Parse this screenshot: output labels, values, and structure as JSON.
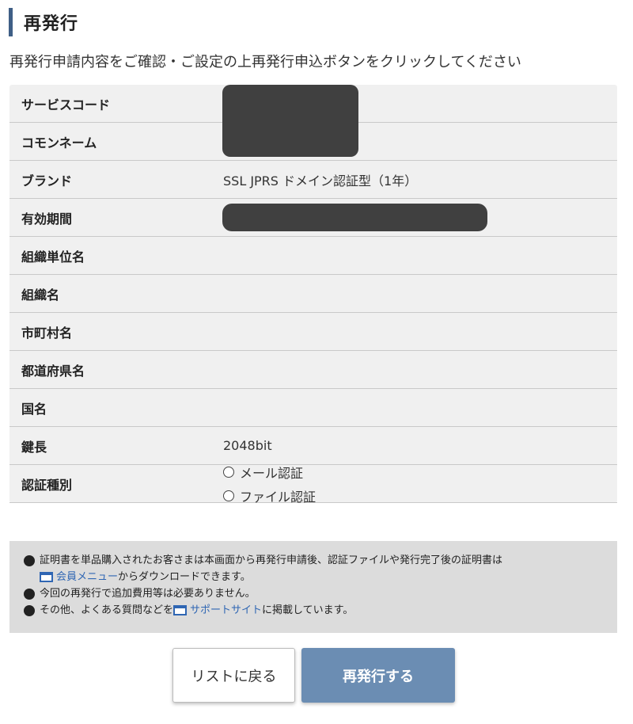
{
  "header": {
    "title": "再発行"
  },
  "instruction": "再発行申請内容をご確認・ご設定の上再発行申込ボタンをクリックしてください",
  "details": {
    "rows": [
      {
        "label": "サービスコード",
        "value": ""
      },
      {
        "label": "コモンネーム",
        "value": ""
      },
      {
        "label": "ブランド",
        "value": "SSL JPRS ドメイン認証型（1年）"
      },
      {
        "label": "有効期間",
        "value": ""
      },
      {
        "label": "組織単位名",
        "value": ""
      },
      {
        "label": "組織名",
        "value": ""
      },
      {
        "label": "市町村名",
        "value": ""
      },
      {
        "label": "都道府県名",
        "value": ""
      },
      {
        "label": "国名",
        "value": ""
      },
      {
        "label": "鍵長",
        "value": "2048bit"
      }
    ],
    "auth": {
      "label": "認証種別",
      "options": [
        "メール認証",
        "ファイル認証"
      ]
    }
  },
  "notes": {
    "line1_text": "証明書を単品購入されたお客さまは本画面から再発行申請後、認証ファイルや発行完了後の証明書は",
    "line1_link": "会員メニュー",
    "line1_after": "からダウンロードできます。",
    "line2_text": "今回の再発行で追加費用等は必要ありません。",
    "line3_before": "その他、よくある質問などを",
    "line3_link": "サポートサイト",
    "line3_after": "に掲載しています。"
  },
  "buttons": {
    "back_label": "リストに戻る",
    "submit_label": "再発行する"
  },
  "colors": {
    "accent": "#3f5f86",
    "submit": "#6b8db3",
    "link": "#2f66b3"
  }
}
